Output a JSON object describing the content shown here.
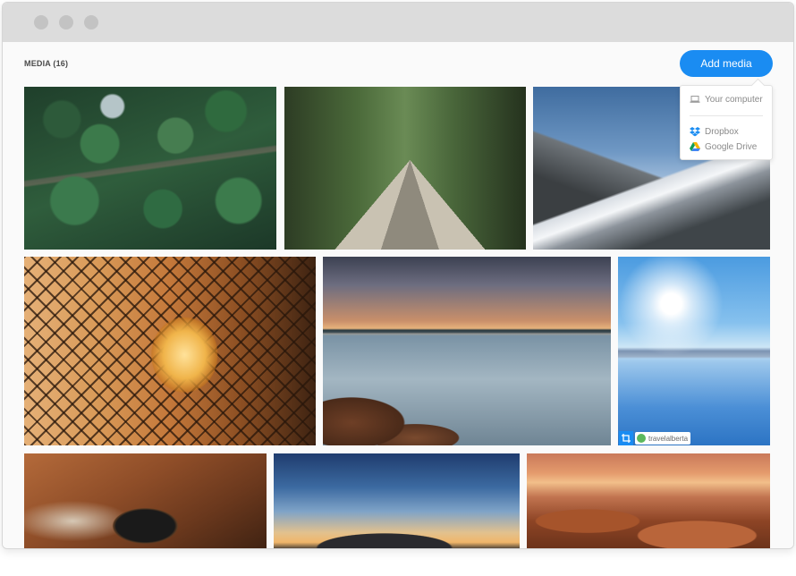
{
  "window": {
    "controls": [
      "close",
      "minimize",
      "maximize"
    ]
  },
  "header": {
    "title": "MEDIA (16)",
    "add_button_label": "Add media"
  },
  "dropdown": {
    "items": [
      {
        "label": "Your computer",
        "icon": "laptop-icon"
      },
      {
        "label": "Dropbox",
        "icon": "dropbox-icon"
      },
      {
        "label": "Google Drive",
        "icon": "google-drive-icon"
      }
    ]
  },
  "gallery": {
    "photos": [
      {
        "name": "forest-aerial-photo"
      },
      {
        "name": "wooden-bridge-photo"
      },
      {
        "name": "mountain-snow-photo"
      },
      {
        "name": "light-bulb-fence-photo"
      },
      {
        "name": "coast-sunset-photo"
      },
      {
        "name": "frozen-lake-photo",
        "credit": "travelalberta"
      },
      {
        "name": "animal-eye-photo"
      },
      {
        "name": "wind-turbines-photo"
      },
      {
        "name": "desert-canyon-photo"
      }
    ]
  },
  "colors": {
    "accent": "#1a8cf2",
    "titlebar": "#dcdcdc",
    "background": "#fafafa"
  }
}
